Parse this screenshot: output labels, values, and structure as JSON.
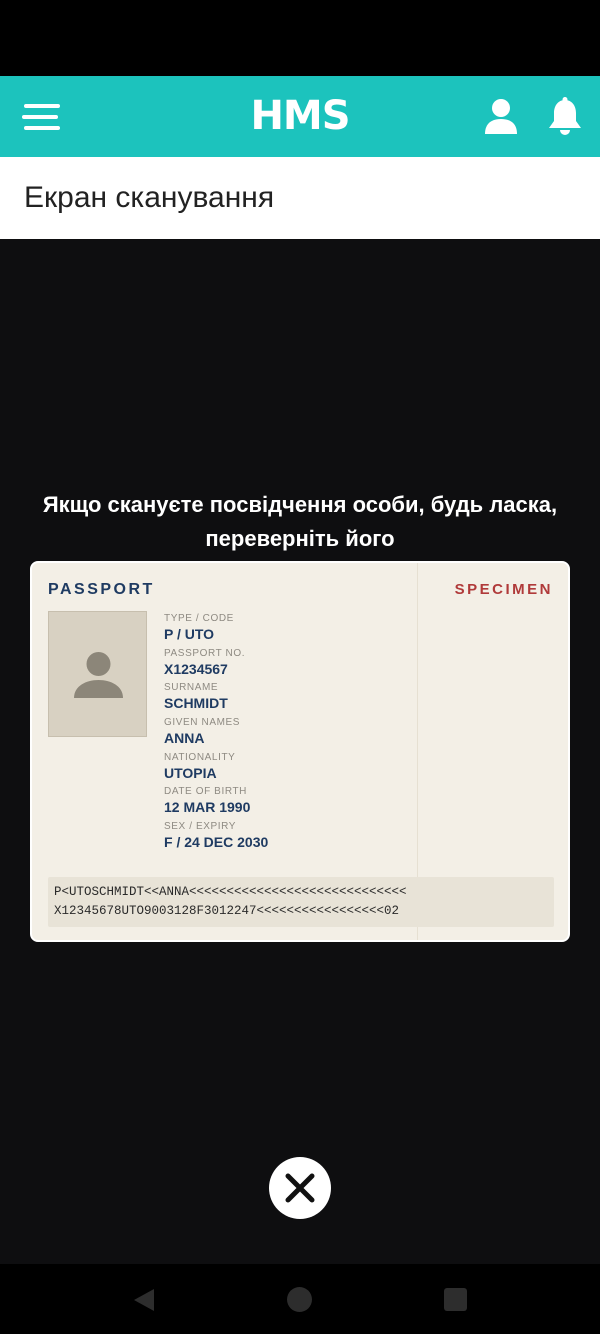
{
  "header": {
    "logo_text": "HMS",
    "accent_color": "#1cc3bd",
    "icons": [
      "hamburger-menu-icon",
      "user-icon",
      "bell-icon"
    ]
  },
  "page": {
    "title": "Екран сканування"
  },
  "scanner": {
    "instruction_line1": "Якщо скануєте посвідчення особи, будь ласка,",
    "instruction_line2": "переверніть його",
    "close_icon": "close-icon"
  },
  "passport": {
    "heading": "PASSPORT",
    "watermark": "SPECIMEN",
    "fields": [
      {
        "label": "TYPE / CODE",
        "value": "P / UTO"
      },
      {
        "label": "PASSPORT NO.",
        "value": "X1234567"
      },
      {
        "label": "SURNAME",
        "value": "SCHMIDT"
      },
      {
        "label": "GIVEN NAMES",
        "value": "ANNA"
      },
      {
        "label": "NATIONALITY",
        "value": "UTOPIA"
      },
      {
        "label": "DATE OF BIRTH",
        "value": "12 MAR 1990"
      },
      {
        "label": "SEX / EXPIRY",
        "value": "F / 24 DEC 2030"
      }
    ],
    "mrz_line1": "P<UTOSCHMIDT<<ANNA<<<<<<<<<<<<<<<<<<<<<<<<<<<<<",
    "mrz_line2": "X12345678UTO9003128F3012247<<<<<<<<<<<<<<<<<02"
  },
  "navigation": {
    "icons": [
      "back-icon",
      "home-icon",
      "recent-apps-icon"
    ]
  }
}
